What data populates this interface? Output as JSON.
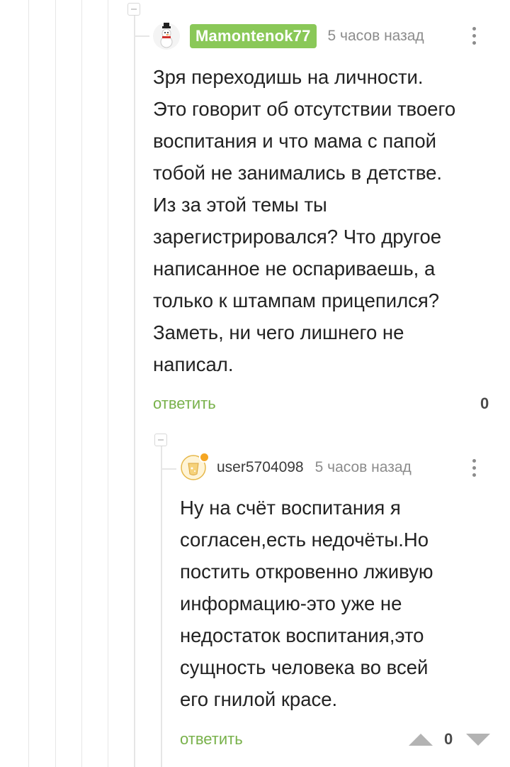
{
  "comments": [
    {
      "username": "Mamontenok77",
      "avatar_icon": "snowman-icon",
      "time": "5 часов назад",
      "text": "Зря переходишь на личности.\nЭто говорит об отсутствии твоего\nвоспитания и что мама с папой\nтобой не занимались в детстве.\nИз за этой темы ты\nзарегистрировался? Что другое\nнаписанное не оспариваешь, а\nтолько к штампам прицепился?\nЗаметь, ни чего лишнего не\nнаписал.",
      "reply_label": "ответить",
      "score": "0"
    },
    {
      "username": "user5704098",
      "avatar_icon": "glass-avatar-icon",
      "time": "5 часов назад",
      "text": "Ну на счёт воспитания я\nсогласен,есть недочёты.Но\nпостить откровенно лживую\nинформацию-это уже не\nнедостаток воспитания,это\nсущность человека во всей\nего гнилой красе.",
      "reply_label": "ответить",
      "score": "0"
    }
  ],
  "colors": {
    "accent_green": "#8ac858",
    "reply_green": "#78b14a",
    "meta_gray": "#8c8c8c",
    "thread_line": "#e6e6e6"
  }
}
